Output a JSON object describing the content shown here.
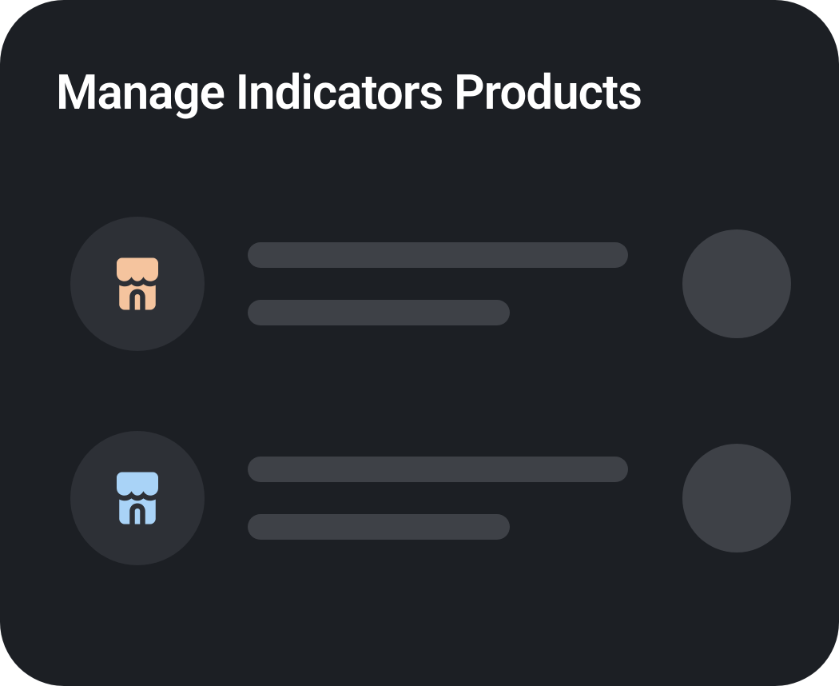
{
  "title": "Manage Indicators Products",
  "items": [
    {
      "icon_name": "store-icon",
      "icon_color": "#f5c49e"
    },
    {
      "icon_name": "store-icon",
      "icon_color": "#a9d3f7"
    }
  ]
}
